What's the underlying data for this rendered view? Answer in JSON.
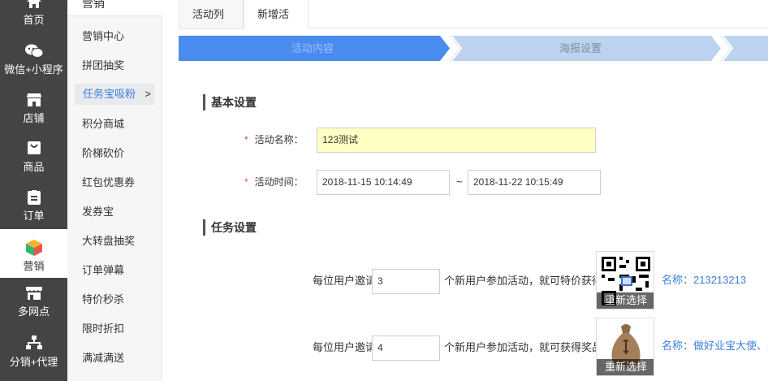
{
  "nav": {
    "items": [
      {
        "label": "首页",
        "icon": "home-icon"
      },
      {
        "label": "微信+小程序",
        "icon": "wechat-icon"
      },
      {
        "label": "店铺",
        "icon": "store-icon"
      },
      {
        "label": "商品",
        "icon": "bag-icon"
      },
      {
        "label": "订单",
        "icon": "order-icon"
      },
      {
        "label": "营销",
        "icon": "cube-icon"
      },
      {
        "label": "多网点",
        "icon": "shop-icon"
      },
      {
        "label": "分销+代理",
        "icon": "org-icon"
      }
    ]
  },
  "subnav": {
    "title": "营销",
    "items": [
      "营销中心",
      "拼团抽奖",
      "任务宝吸粉",
      "积分商城",
      "阶梯砍价",
      "红包优惠券",
      "发券宝",
      "大转盘抽奖",
      "订单弹幕",
      "特价秒杀",
      "限时折扣",
      "满减满送"
    ],
    "active_arrow": ">"
  },
  "tabs": [
    "活动列表",
    "新增活动"
  ],
  "steps": [
    "活动内容",
    "海报设置"
  ],
  "basic": {
    "title": "基本设置",
    "name_label": "活动名称：",
    "name_value": "123测试",
    "time_label": "活动时间：",
    "required_mark": "*",
    "start": "2018-11-15 10:14:49",
    "tilde": "~",
    "end": "2018-11-22 10:15:49"
  },
  "task": {
    "title": "任务设置",
    "rows": [
      {
        "prefix": "每位用户邀请",
        "count": "3",
        "suffix": "个新用户参加活动，就可特价获得",
        "reselect": "重新选择",
        "name": "名称：213213213"
      },
      {
        "prefix": "每位用户邀请",
        "count": "4",
        "suffix": "个新用户参加活动，就可获得奖品",
        "reselect": "重新选择",
        "name": "名称：做好业宝大使、赠"
      }
    ]
  },
  "colors": {
    "nav_bg": "#444444",
    "step_active": "#4a8bf0",
    "step_inactive": "#bcd2ee",
    "accent": "#3a7fe0"
  }
}
